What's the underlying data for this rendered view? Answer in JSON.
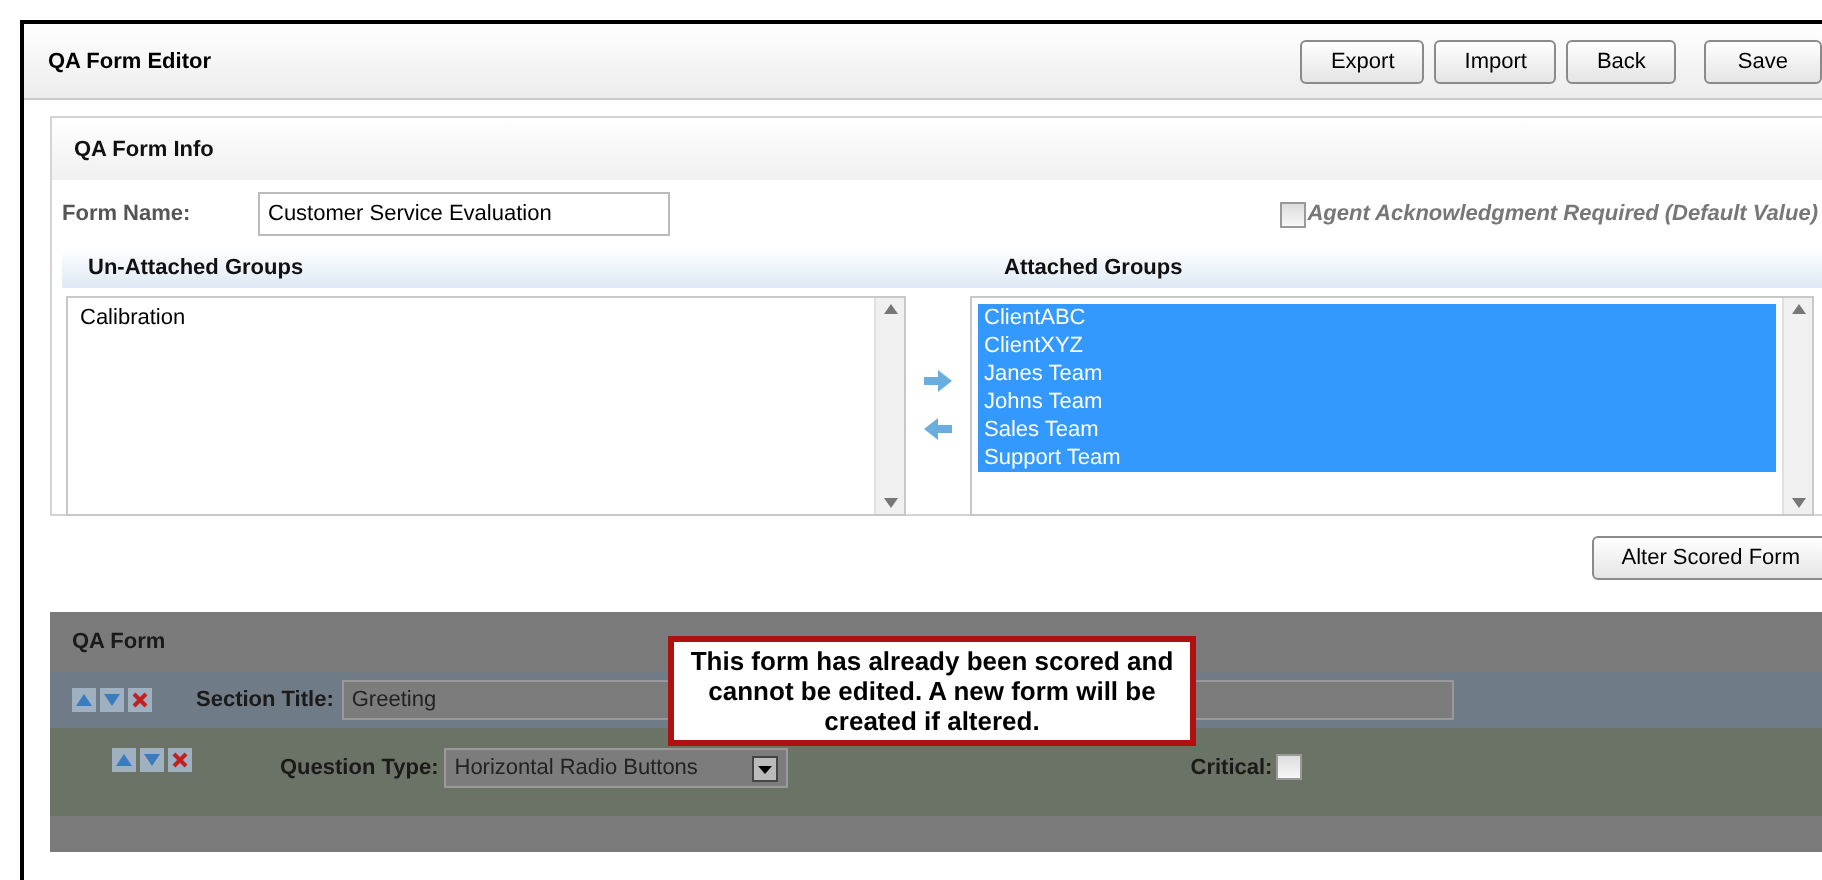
{
  "window": {
    "title": "QA Form Editor"
  },
  "toolbar": [
    "Export",
    "Import",
    "Back",
    "Save"
  ],
  "form_info": {
    "title": "QA Form Info",
    "form_name_label": "Form Name:",
    "form_name": "Customer Service Evaluation",
    "ack": {
      "label": "Agent Acknowledgment Required (Default Value)",
      "checked": false
    }
  },
  "unattached": {
    "title": "Un-Attached Groups",
    "items": [
      {
        "label": "Calibration",
        "selected": false
      }
    ]
  },
  "attached": {
    "title": "Attached Groups",
    "items": [
      {
        "label": "ClientABC",
        "selected": true
      },
      {
        "label": "ClientXYZ",
        "selected": true
      },
      {
        "label": "Janes Team",
        "selected": true
      },
      {
        "label": "Johns Team",
        "selected": true
      },
      {
        "label": "Sales Team",
        "selected": true
      },
      {
        "label": "Support Team",
        "selected": true
      }
    ]
  },
  "alter_button": "Alter Scored Form",
  "qa_form": {
    "title": "QA Form",
    "locked": true,
    "message": "This form has already been scored and cannot be edited. A new form will be created if altered.",
    "section": {
      "label": "Section Title:",
      "value": "Greeting"
    },
    "question": {
      "type_label": "Question Type:",
      "type_value": "Horizontal Radio Buttons",
      "critical_label": "Critical:",
      "critical": false
    }
  }
}
